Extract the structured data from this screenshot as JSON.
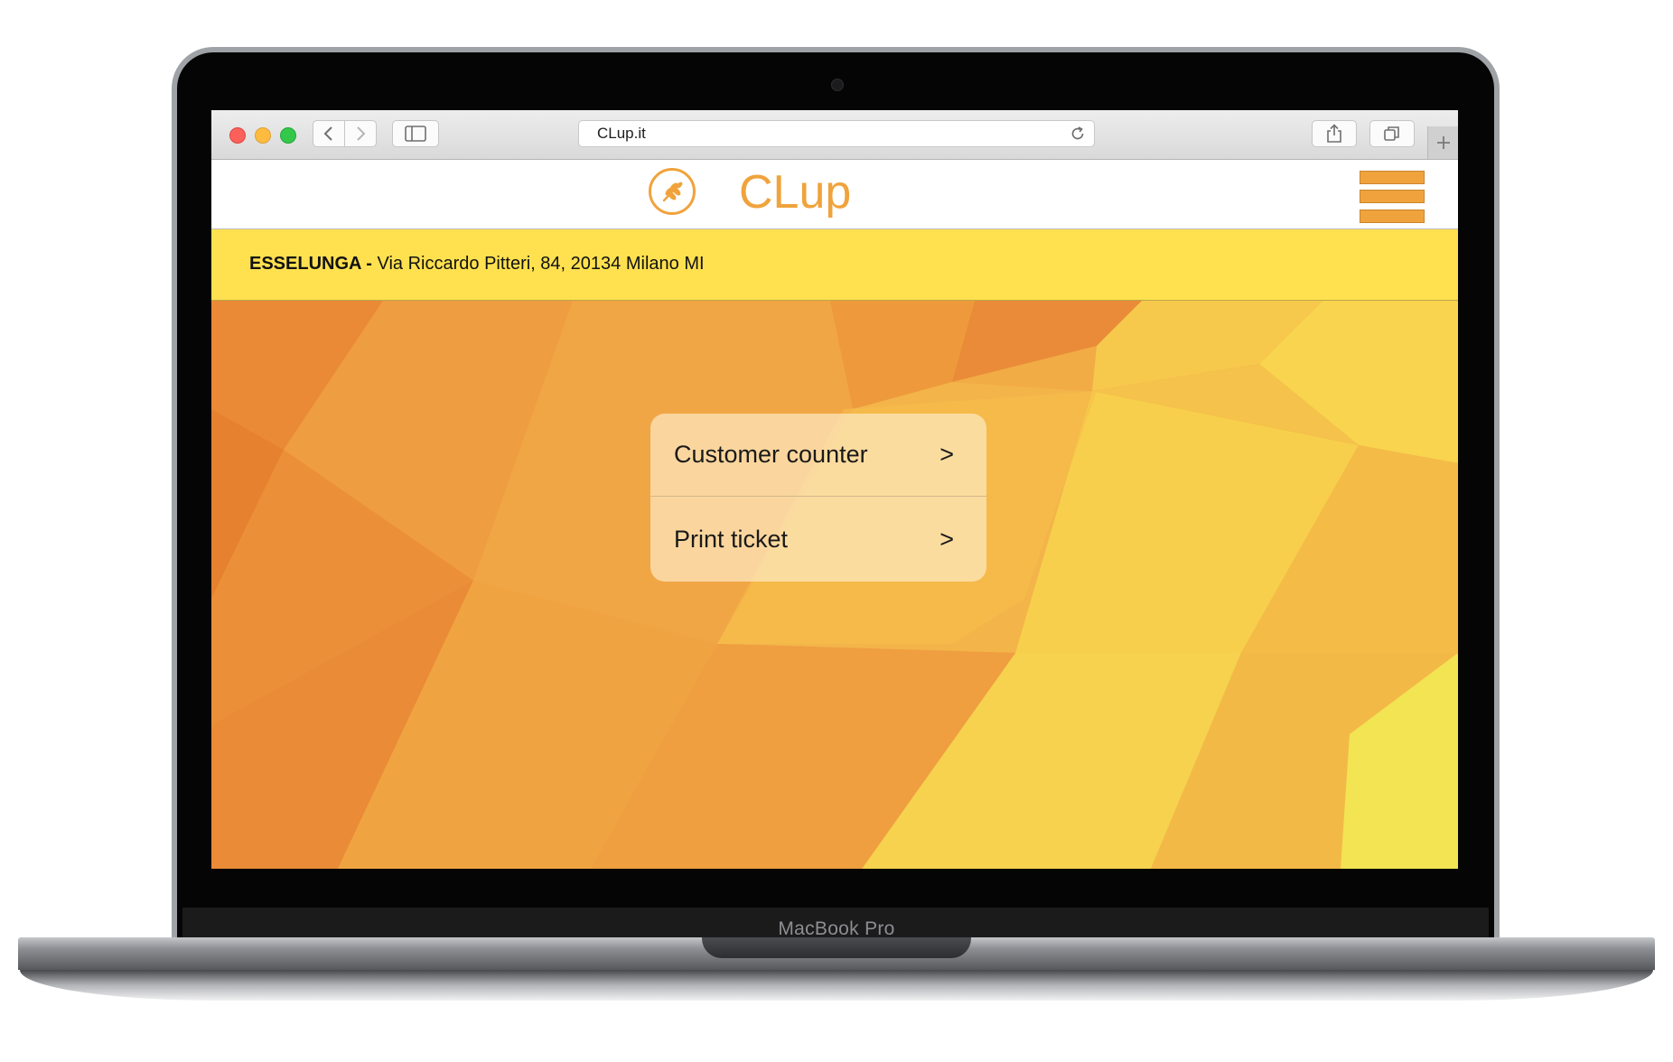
{
  "device": {
    "brand_label": "MacBook Pro"
  },
  "browser": {
    "url": "CLup.it",
    "icons": {
      "back": "chevron-left-icon",
      "forward": "chevron-right-icon",
      "sidebar": "sidebar-icon",
      "reload": "reload-icon",
      "share": "share-icon",
      "tabs": "tabs-icon",
      "new_tab": "plus-icon"
    }
  },
  "header": {
    "logo_icon": "wheat-logo-icon",
    "title": "CLup",
    "menu_icon": "hamburger-menu-icon",
    "accent_color": "#f0a33c"
  },
  "store": {
    "name": "ESSELUNGA -",
    "address": "Via Riccardo Pitteri, 84, 20134 Milano MI",
    "banner_color": "#ffe14f"
  },
  "menu": {
    "items": [
      {
        "label": "Customer counter",
        "arrow": ">"
      },
      {
        "label": "Print ticket",
        "arrow": ">"
      }
    ]
  }
}
